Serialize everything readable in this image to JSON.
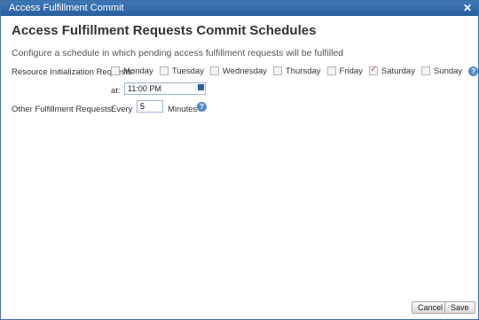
{
  "window": {
    "title": "Access Fulfillment Commit",
    "close_label": "✕"
  },
  "header": {
    "title": "Access Fulfillment Requests Commit Schedules",
    "subtitle": "Configure a schedule in which pending access fulfillment requests will be fulfilled"
  },
  "resource_init": {
    "label": "Resource Initialization Requests:",
    "days": [
      {
        "label": "Monday",
        "checked": false
      },
      {
        "label": "Tuesday",
        "checked": false
      },
      {
        "label": "Wednesday",
        "checked": false
      },
      {
        "label": "Thursday",
        "checked": false
      },
      {
        "label": "Friday",
        "checked": false
      },
      {
        "label": "Saturday",
        "checked": true
      },
      {
        "label": "Sunday",
        "checked": false
      }
    ],
    "at_label": "at:",
    "time_value": "11:00 PM"
  },
  "other_fulfillment": {
    "label": "Other Fulfillment Requests:",
    "every_label": "Every",
    "minutes_value": "5",
    "minutes_label": "Minutes"
  },
  "buttons": {
    "cancel": "Cancel",
    "save": "Save"
  },
  "colors": {
    "titlebar": "#3f79bb",
    "help_icon": "#5289c4",
    "checkmark": "#c65b5b"
  }
}
